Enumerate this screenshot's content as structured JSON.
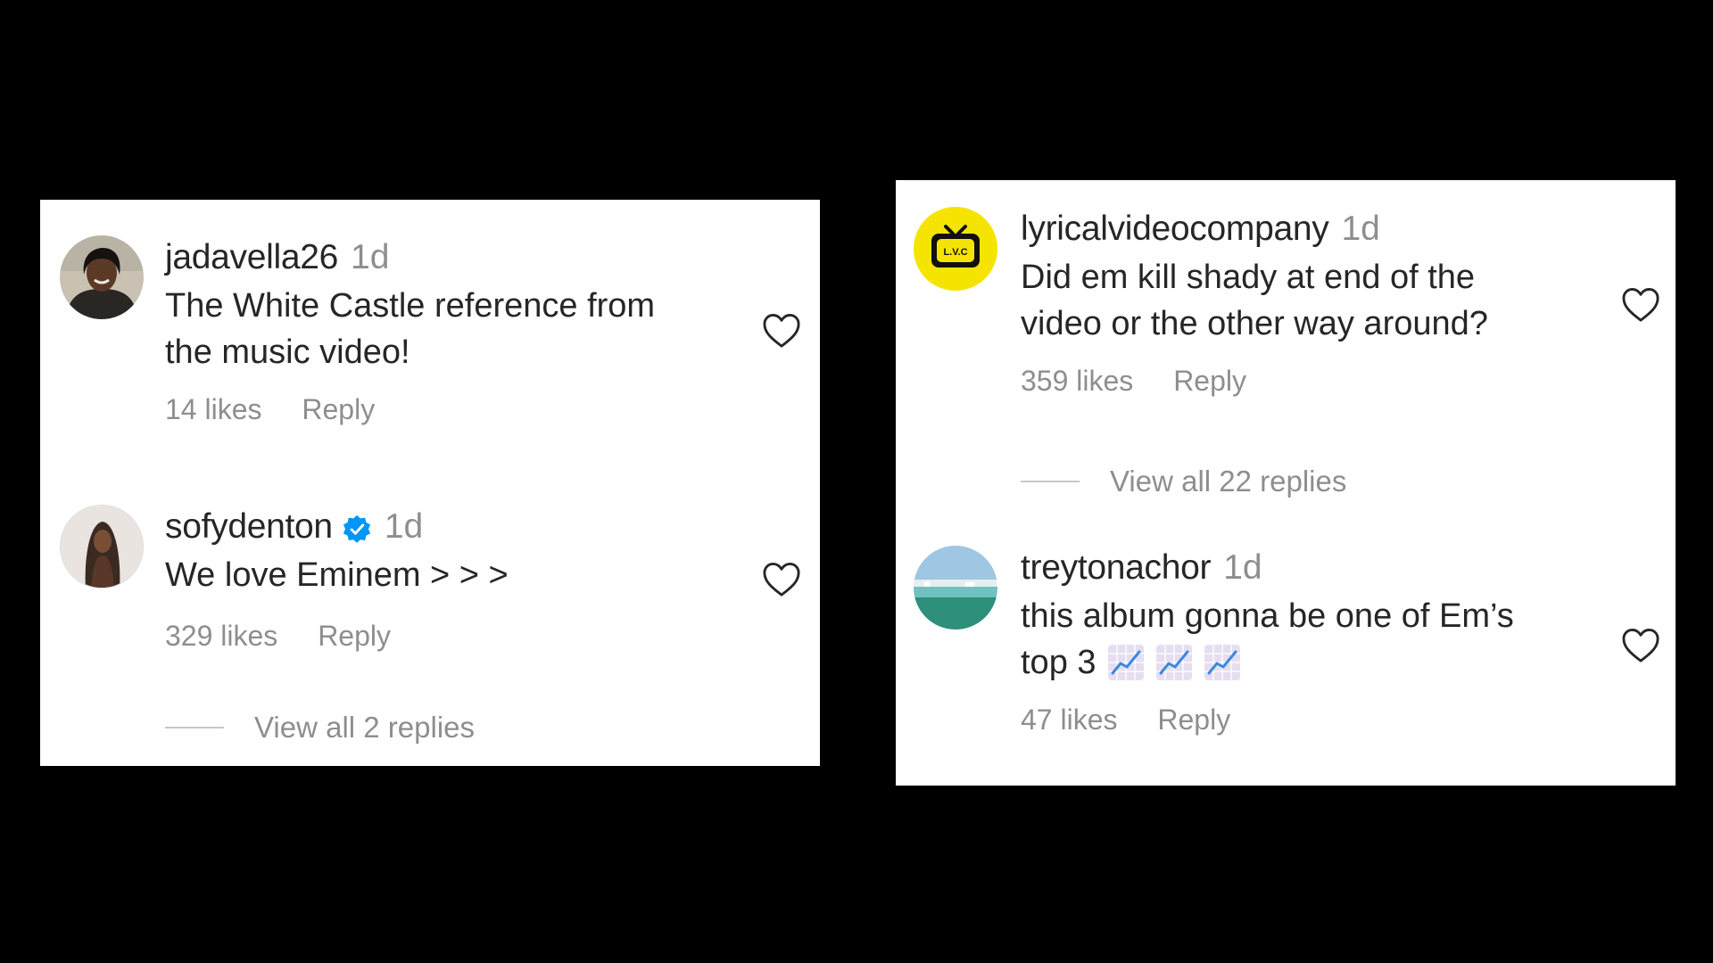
{
  "left_panel": {
    "comments": [
      {
        "avatar": "person-avatar",
        "username": "jadavella26",
        "time": "1d",
        "text_lines": [
          "The White Castle reference from",
          "the music video!"
        ],
        "likes": "14 likes",
        "reply": "Reply",
        "like_icon": "heart-icon"
      },
      {
        "avatar": "person-avatar",
        "username": "sofydenton",
        "verified_icon": "verified-badge-icon",
        "time": "1d",
        "text_lines": [
          "We love Eminem > > >"
        ],
        "likes": "329 likes",
        "reply": "Reply",
        "like_icon": "heart-icon"
      }
    ],
    "view_replies": "View all 2 replies"
  },
  "right_panel": {
    "comments": [
      {
        "avatar": "lvc-tv-logo-avatar",
        "avatar_text": "L.V.C",
        "username": "lyricalvideocompany",
        "time": "1d",
        "text_lines": [
          "Did em kill shady at end of the",
          "video or the other way around?"
        ],
        "likes": "359 likes",
        "reply": "Reply",
        "like_icon": "heart-icon"
      },
      {
        "avatar": "beach-avatar",
        "username": "treytonachor",
        "time": "1d",
        "text_lines": [
          "this album gonna be one of Em’s",
          "top 3"
        ],
        "emoji_icon": "chart-increasing-emoji",
        "emoji_count": 3,
        "likes": "47 likes",
        "reply": "Reply",
        "like_icon": "heart-icon"
      }
    ],
    "view_replies": "View all 22 replies"
  },
  "colors": {
    "background": "#000000",
    "panel": "#ffffff",
    "primary_text": "#262626",
    "secondary_text": "#8e8e8e",
    "verified": "#0095f6",
    "lvc_yellow": "#f5e300"
  }
}
